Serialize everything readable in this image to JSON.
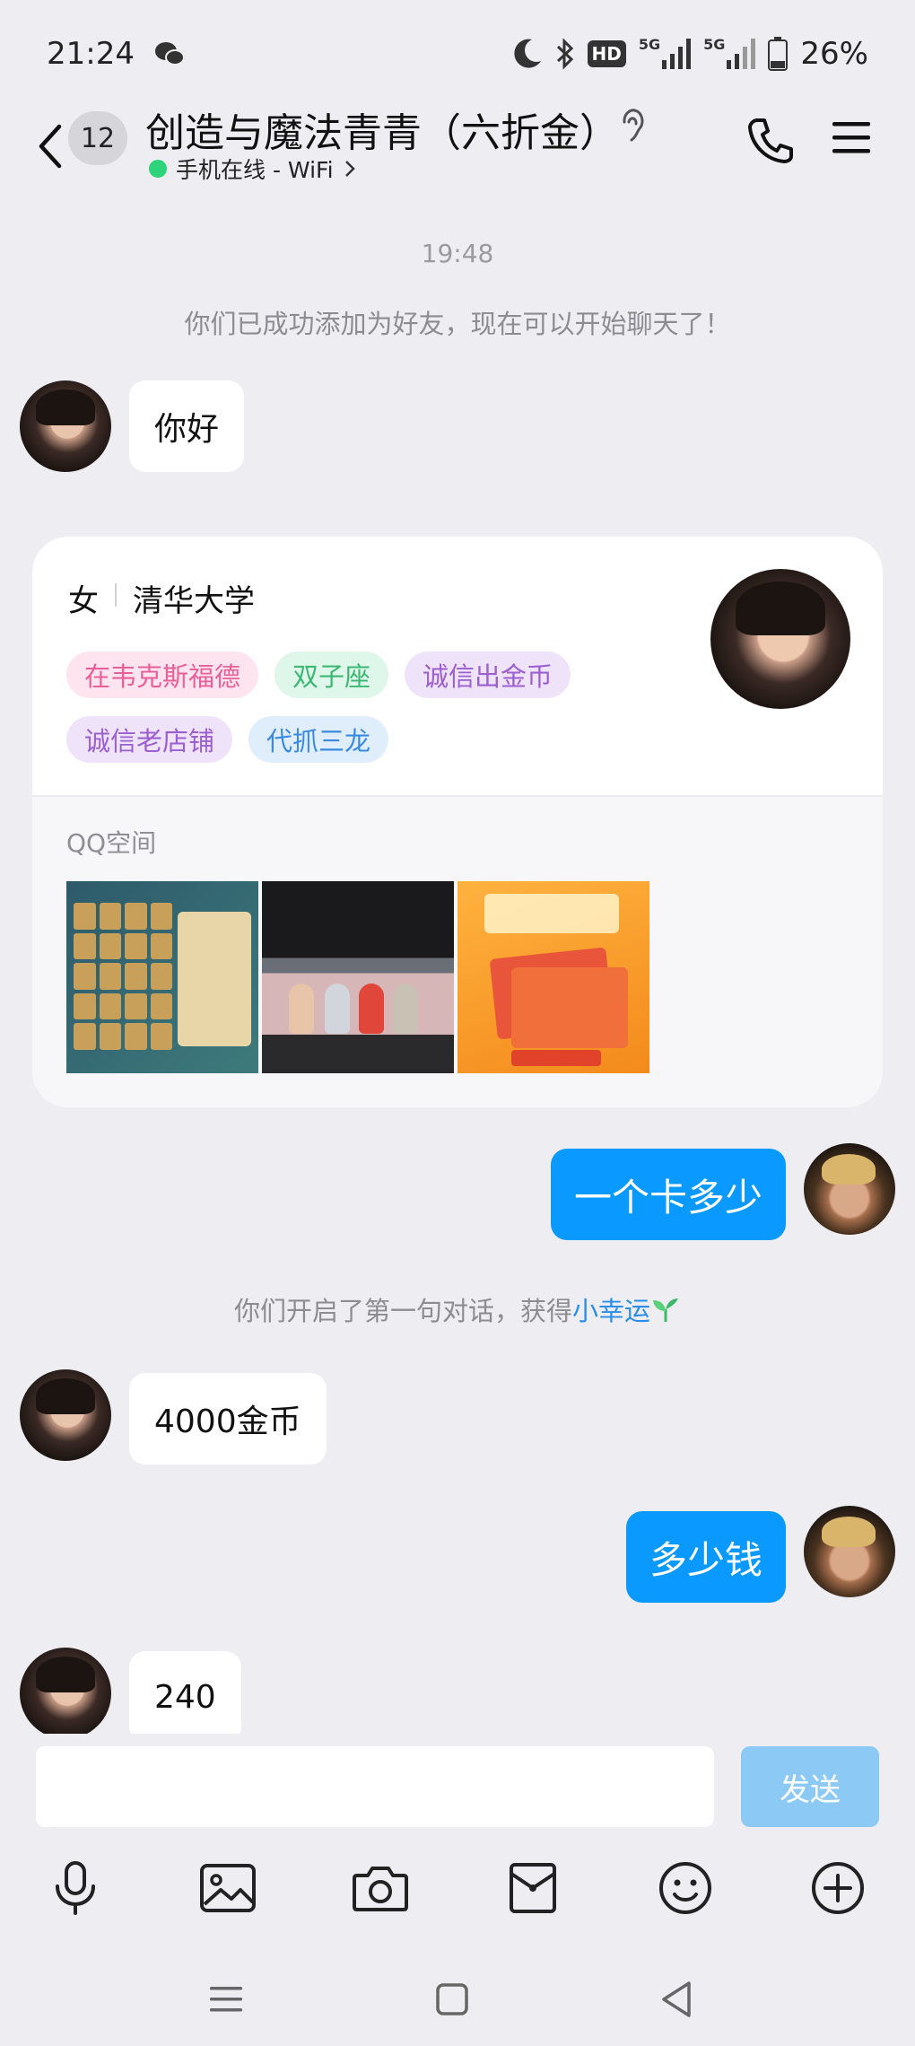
{
  "status_bar": {
    "time": "21:24",
    "hd_label": "HD",
    "signal_1": "5G",
    "signal_2": "5G",
    "battery": "26%"
  },
  "header": {
    "unread_count": "12",
    "title": "创造与魔法青青（六折金）",
    "online_status": "手机在线 - WiFi"
  },
  "messages": {
    "timestamp": "19:48",
    "friend_added": "你们已成功添加为好友，现在可以开始聊天了！",
    "msg_hello": "你好",
    "msg_price_card": "一个卡多少",
    "first_chat_prefix": "你们开启了第一句对话，获得",
    "first_chat_link": "小幸运",
    "msg_4000": "4000金币",
    "msg_how_much": "多少钱",
    "msg_240": "240"
  },
  "profile_card": {
    "gender": "女",
    "school": "清华大学",
    "tags": [
      {
        "label": "在韦克斯福德",
        "bg": "#fde4ef",
        "fg": "#e8609a"
      },
      {
        "label": "双子座",
        "bg": "#dff6ea",
        "fg": "#3cb874"
      },
      {
        "label": "诚信出金币",
        "bg": "#efe3fa",
        "fg": "#9b5fd0"
      },
      {
        "label": "诚信老店铺",
        "bg": "#efe3fa",
        "fg": "#9b5fd0"
      },
      {
        "label": "代抓三龙",
        "bg": "#e0eefc",
        "fg": "#3a8be0"
      }
    ],
    "qzone_label": "QQ空间"
  },
  "input": {
    "placeholder": "",
    "send_label": "发送"
  },
  "toolbar_icons": [
    "microphone-icon",
    "image-icon",
    "camera-icon",
    "red-packet-icon",
    "emoji-icon",
    "plus-circle-icon"
  ],
  "colors": {
    "accent": "#0a99ff",
    "send_disabled": "#8dc9f5",
    "online": "#2ed47a",
    "link": "#2a8ee8"
  }
}
